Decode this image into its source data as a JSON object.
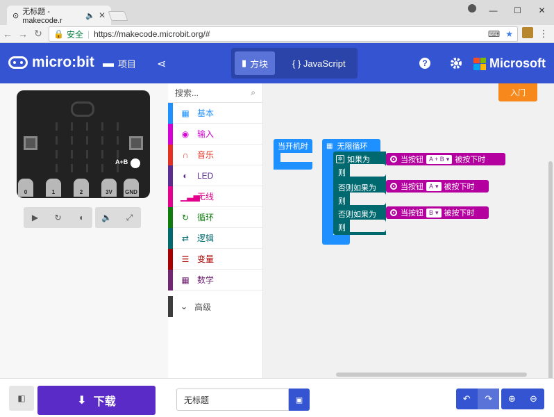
{
  "browser": {
    "tab_title": "无标题 - makecode.r",
    "tab_close": "✕",
    "window_min": "—",
    "window_max": "☐",
    "window_close": "✕",
    "secure_label": "安全",
    "url": "https://makecode.microbit.org/#"
  },
  "header": {
    "logo_text": "micro:bit",
    "projects_label": "项目",
    "mode_blocks": "方块",
    "mode_js": "{ } JavaScript",
    "brand": "Microsoft"
  },
  "simulator": {
    "pins": [
      "0",
      "1",
      "2",
      "3V",
      "GND"
    ],
    "ab_label": "A+B"
  },
  "toolbox": {
    "search_placeholder": "搜索...",
    "categories": [
      {
        "label": "基本",
        "color": "#1e90ff",
        "icon": "grid-icon"
      },
      {
        "label": "输入",
        "color": "#d400d4",
        "icon": "target-icon"
      },
      {
        "label": "音乐",
        "color": "#e63022",
        "icon": "headphones-icon"
      },
      {
        "label": "LED",
        "color": "#5c2d91",
        "icon": "toggle-icon"
      },
      {
        "label": "无线",
        "color": "#e3008c",
        "icon": "signal-icon"
      },
      {
        "label": "循环",
        "color": "#107c10",
        "icon": "loop-icon"
      },
      {
        "label": "逻辑",
        "color": "#006970",
        "icon": "shuffle-icon"
      },
      {
        "label": "变量",
        "color": "#a80000",
        "icon": "list-icon"
      },
      {
        "label": "数学",
        "color": "#712672",
        "icon": "calculator-icon"
      }
    ],
    "advanced": "高级"
  },
  "workspace": {
    "tutorial_button": "入门",
    "on_start": "当开机时",
    "forever": "无限循环",
    "if_label": "如果为",
    "then_label": "则",
    "elseif_label": "否则如果为",
    "button_prefix": "当按钮",
    "button_suffix": "被按下时",
    "buttons": [
      "A + B",
      "A",
      "B"
    ]
  },
  "footer": {
    "download": "下载",
    "project_name": "无标题"
  }
}
